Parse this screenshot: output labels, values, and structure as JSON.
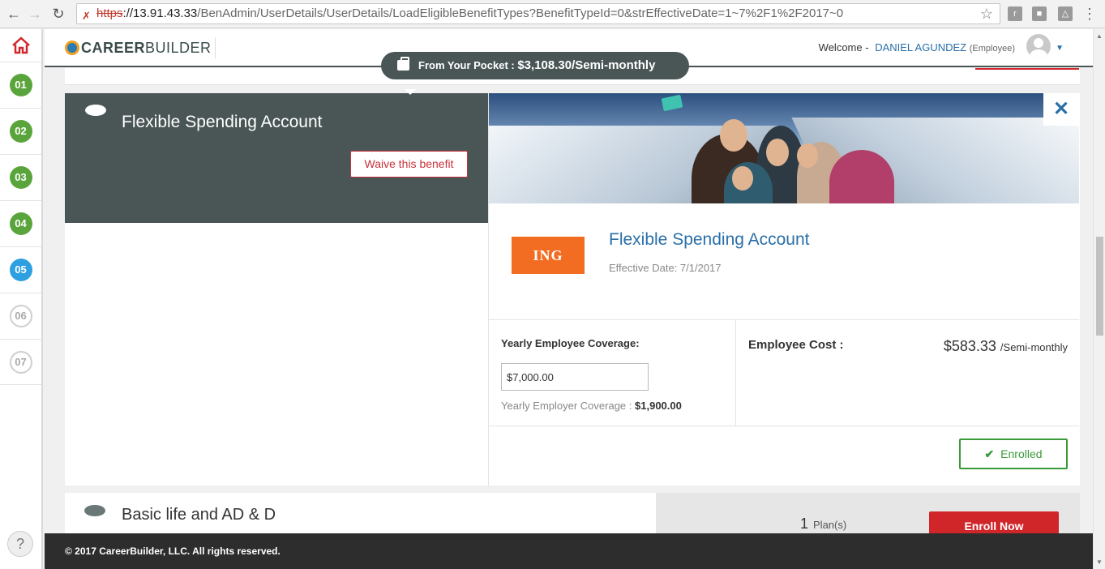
{
  "browser": {
    "url_protocol": "https",
    "url_host": "://13.91.43.33",
    "url_path": "/BenAdmin/UserDetails/UserDetails/LoadEligibleBenefitTypes?BenefitTypeId=0&strEffectiveDate=1~7%2F1%2F2017~0"
  },
  "sidebar": {
    "steps": [
      {
        "label": "01",
        "state": "done"
      },
      {
        "label": "02",
        "state": "done"
      },
      {
        "label": "03",
        "state": "done"
      },
      {
        "label": "04",
        "state": "done"
      },
      {
        "label": "05",
        "state": "active"
      },
      {
        "label": "06",
        "state": "todo"
      },
      {
        "label": "07",
        "state": "todo"
      }
    ],
    "help_label": "?"
  },
  "header": {
    "logo_bold": "CAREER",
    "logo_light": "BUILDER",
    "welcome": "Welcome -",
    "user_name": "DANIEL AGUNDEZ",
    "user_role": "(Employee)"
  },
  "pocket": {
    "label": "From Your Pocket :",
    "amount": "$3,108.30/Semi-monthly"
  },
  "fsa": {
    "title": "Flexible Spending Account",
    "waive_label": "Waive this benefit",
    "carrier_logo_text": "ING",
    "plan_name": "Flexible Spending Account",
    "effective_date": "Effective Date: 7/1/2017",
    "coverage_label": "Yearly Employee Coverage:",
    "coverage_value": "$7,000.00",
    "employer_label": "Yearly Employer Coverage :",
    "employer_value": "$1,900.00",
    "cost_label": "Employee Cost :",
    "cost_value": "$583.33",
    "cost_period": "/Semi-monthly",
    "enrolled_label": "Enrolled"
  },
  "life": {
    "title": "Basic life and AD & D",
    "plans_count": "1",
    "plans_label": "Plan(s)",
    "enroll_label": "Enroll Now"
  },
  "footer": {
    "copyright": "© 2017 CareerBuilder, LLC. All rights reserved."
  },
  "colors": {
    "dark_panel": "#4a5656",
    "link_blue": "#2a6fa8",
    "red": "#d0262a",
    "green": "#5aa43c",
    "active_blue": "#2e9fe0"
  }
}
